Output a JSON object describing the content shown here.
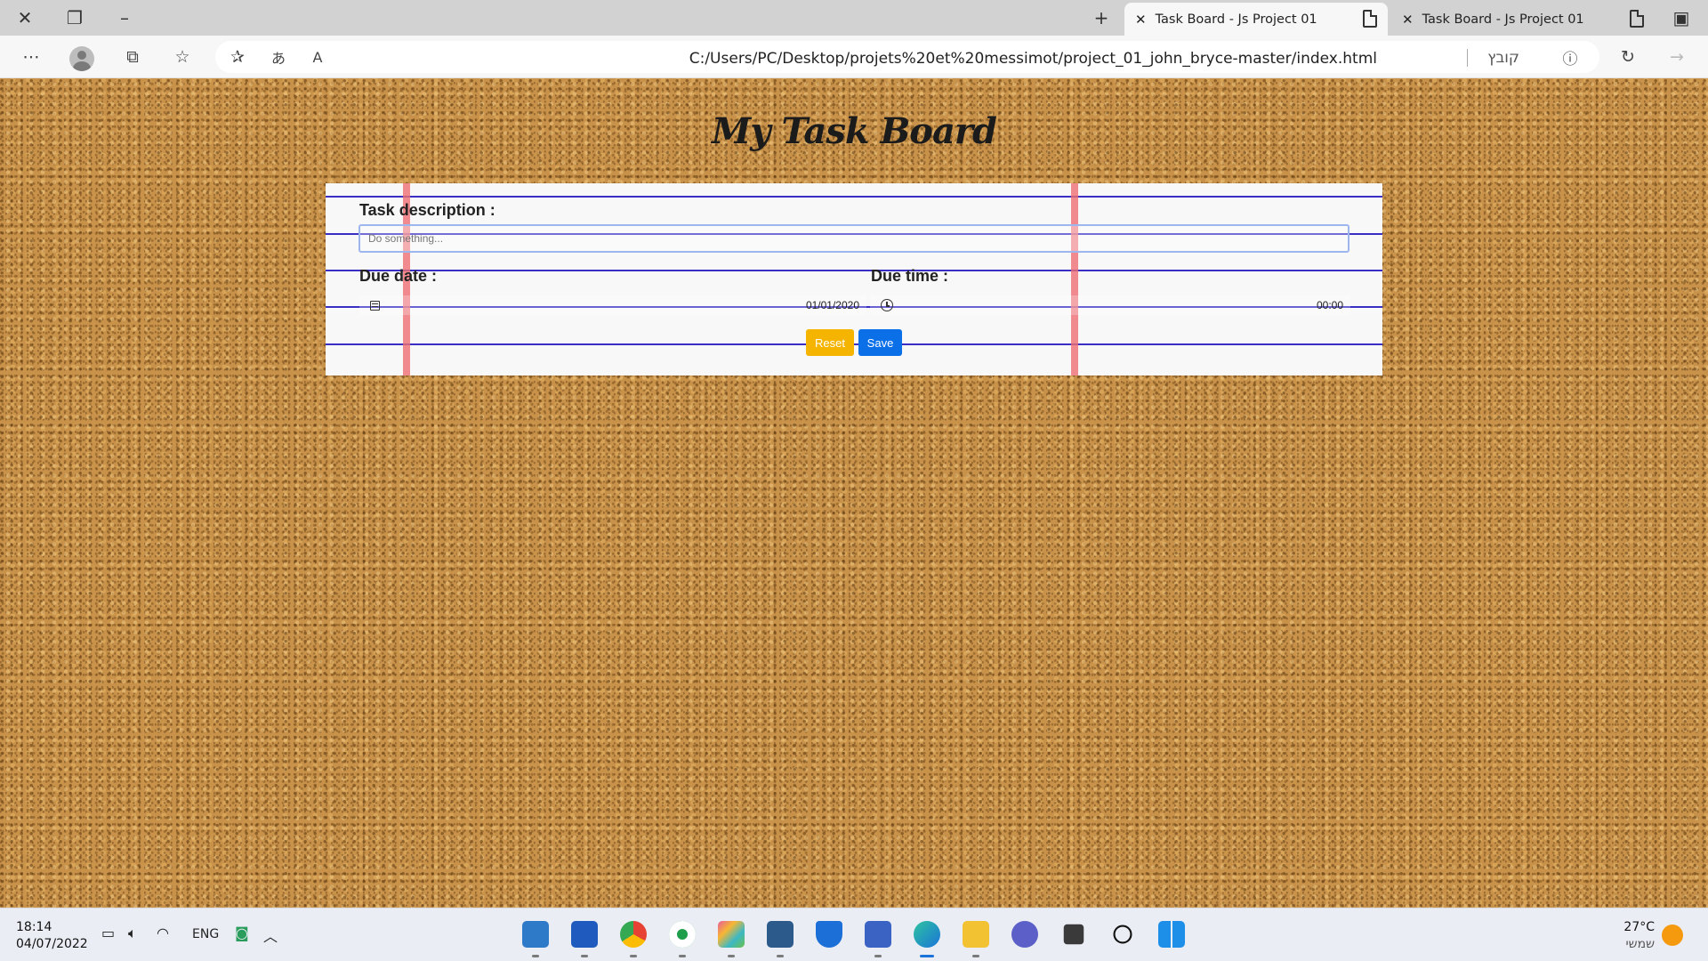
{
  "browser": {
    "tabs": [
      {
        "title": "Task Board - Js Project 01",
        "active": true
      },
      {
        "title": "Task Board - Js Project 01",
        "active": false
      }
    ],
    "url": "C:/Users/PC/Desktop/projets%20et%20messimot/project_01_john_bryce-master/index.html",
    "url_label": "קובץ",
    "icons": [
      "close-icon",
      "restore-icon",
      "minimize-icon",
      "new-tab-icon",
      "more-icon",
      "profile-icon",
      "collections-icon",
      "favorites-icon",
      "add-favorite-icon",
      "translate-icon",
      "read-aloud-icon",
      "info-icon",
      "refresh-icon",
      "forward-icon"
    ]
  },
  "page": {
    "title": "My Task Board",
    "form": {
      "description_label": "Task description :",
      "description_placeholder": "Do something...",
      "due_date_label": "Due date :",
      "due_date_value": "01/01/2020",
      "due_time_label": "Due time :",
      "due_time_value": "00:00",
      "reset_label": "Reset",
      "save_label": "Save"
    },
    "colors": {
      "reset": "#f5b400",
      "save": "#0b6fe8",
      "ruled_line": "#3a2fc4",
      "margin_line": "#ee6e73"
    }
  },
  "taskbar": {
    "time": "18:14",
    "date": "04/07/2022",
    "language": "ENG",
    "temperature": "27°C",
    "weather_text": "שמשי",
    "apps": [
      "photos-icon",
      "word-icon",
      "chrome-icon",
      "mongodb-compass-icon",
      "git-kraken-icon",
      "mysql-workbench-icon",
      "defender-icon",
      "store-icon",
      "edge-icon",
      "file-explorer-icon",
      "chat-icon",
      "task-view-icon",
      "search-icon",
      "start-icon"
    ]
  }
}
